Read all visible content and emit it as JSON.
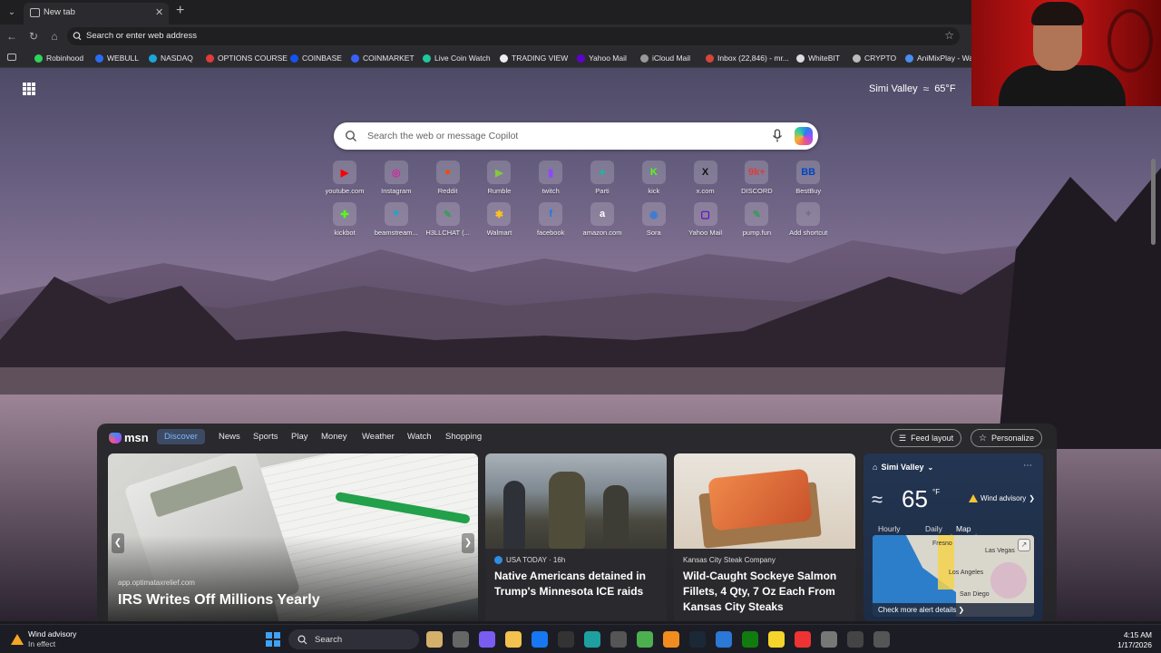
{
  "tab": {
    "title": "New tab"
  },
  "omnibox": {
    "placeholder": "Search or enter web address"
  },
  "bookmarks": [
    {
      "label": "Robinhood",
      "color": "#2fd45b"
    },
    {
      "label": "WEBULL",
      "color": "#2b6cf5"
    },
    {
      "label": "NASDAQ",
      "color": "#1aa6d9"
    },
    {
      "label": "OPTIONS COURSE",
      "color": "#e03b3b"
    },
    {
      "label": "COINBASE",
      "color": "#1652f0"
    },
    {
      "label": "COINMARKET",
      "color": "#3861fb"
    },
    {
      "label": "Live Coin Watch",
      "color": "#1fc8a0"
    },
    {
      "label": "TRADING VIEW",
      "color": "#eeeeee"
    },
    {
      "label": "Yahoo Mail",
      "color": "#6001d2"
    },
    {
      "label": "iCloud Mail",
      "color": "#999999"
    },
    {
      "label": "Inbox (22,846) - mr...",
      "color": "#d44638"
    },
    {
      "label": "WhiteBIT",
      "color": "#dddddd"
    },
    {
      "label": "CRYPTO",
      "color": "#bbbbbb"
    },
    {
      "label": "AniMixPlay - Wa...",
      "color": "#4a8cf0"
    }
  ],
  "weather_top": {
    "location": "Simi Valley",
    "temp": "65°F"
  },
  "search": {
    "placeholder": "Search the web or message Copilot"
  },
  "shortcuts_row1": [
    {
      "name": "youtube.com",
      "glyph": "▶",
      "color": "#ff0000"
    },
    {
      "name": "Instagram",
      "glyph": "◎",
      "color": "#d6249f"
    },
    {
      "name": "Reddit",
      "glyph": "●",
      "color": "#ff4500"
    },
    {
      "name": "Rumble",
      "glyph": "▶",
      "color": "#85c742"
    },
    {
      "name": "twitch",
      "glyph": "▮",
      "color": "#9146ff"
    },
    {
      "name": "Parti",
      "glyph": "✦",
      "color": "#1fb5a0"
    },
    {
      "name": "kick",
      "glyph": "K",
      "color": "#53fc18"
    },
    {
      "name": "x.com",
      "glyph": "X",
      "color": "#111111"
    },
    {
      "name": "DISCORD",
      "glyph": "9k+",
      "color": "#e03b3b"
    },
    {
      "name": "BestBuy",
      "glyph": "BB",
      "color": "#0046be"
    }
  ],
  "shortcuts_row2": [
    {
      "name": "kickbot",
      "glyph": "✚",
      "color": "#53fc18"
    },
    {
      "name": "beamstream...",
      "glyph": "▼",
      "color": "#1fa6c7"
    },
    {
      "name": "H3LLCHAT (...",
      "glyph": "✎",
      "color": "#3a9a5b"
    },
    {
      "name": "Walmart",
      "glyph": "✱",
      "color": "#ffc220"
    },
    {
      "name": "facebook",
      "glyph": "f",
      "color": "#1877f2"
    },
    {
      "name": "amazon.com",
      "glyph": "a",
      "color": "#ffffff"
    },
    {
      "name": "Sora",
      "glyph": "◉",
      "color": "#3a7bd5"
    },
    {
      "name": "Yahoo Mail",
      "glyph": "▢",
      "color": "#6001d2"
    },
    {
      "name": "pump.fun",
      "glyph": "✎",
      "color": "#3a9a5b"
    },
    {
      "name": "Add shortcut",
      "glyph": "+",
      "color": "#6d6d78"
    }
  ],
  "msn": {
    "logo": "msn",
    "nav": [
      "Discover",
      "News",
      "Sports",
      "Play",
      "Money",
      "Weather",
      "Watch",
      "Shopping"
    ],
    "feed_layout": "Feed layout",
    "personalize": "Personalize"
  },
  "cards": [
    {
      "source": "app.optimataxrelief.com",
      "title": "IRS Writes Off Millions Yearly"
    },
    {
      "source": "USA TODAY · 16h",
      "title": "Native Americans detained in Trump's Minnesota ICE raids"
    },
    {
      "source": "Kansas City Steak Company",
      "title": "Wild-Caught Sockeye Salmon Fillets, 4 Qty, 7 Oz Each From Kansas City Steaks"
    }
  ],
  "weather_card": {
    "location": "Simi Valley",
    "temp": "65",
    "unit": "°F",
    "alert": "Wind advisory",
    "tabs": [
      "Hourly",
      "Daily",
      "Map"
    ],
    "map_labels": [
      "Fresno",
      "Las Vegas",
      "Los Angeles",
      "San Diego"
    ],
    "alert_details": "Check more alert details"
  },
  "taskbar": {
    "weather_title": "Wind advisory",
    "weather_sub": "In effect",
    "search": "Search",
    "time": "4:15 AM",
    "date": "1/17/2026"
  }
}
